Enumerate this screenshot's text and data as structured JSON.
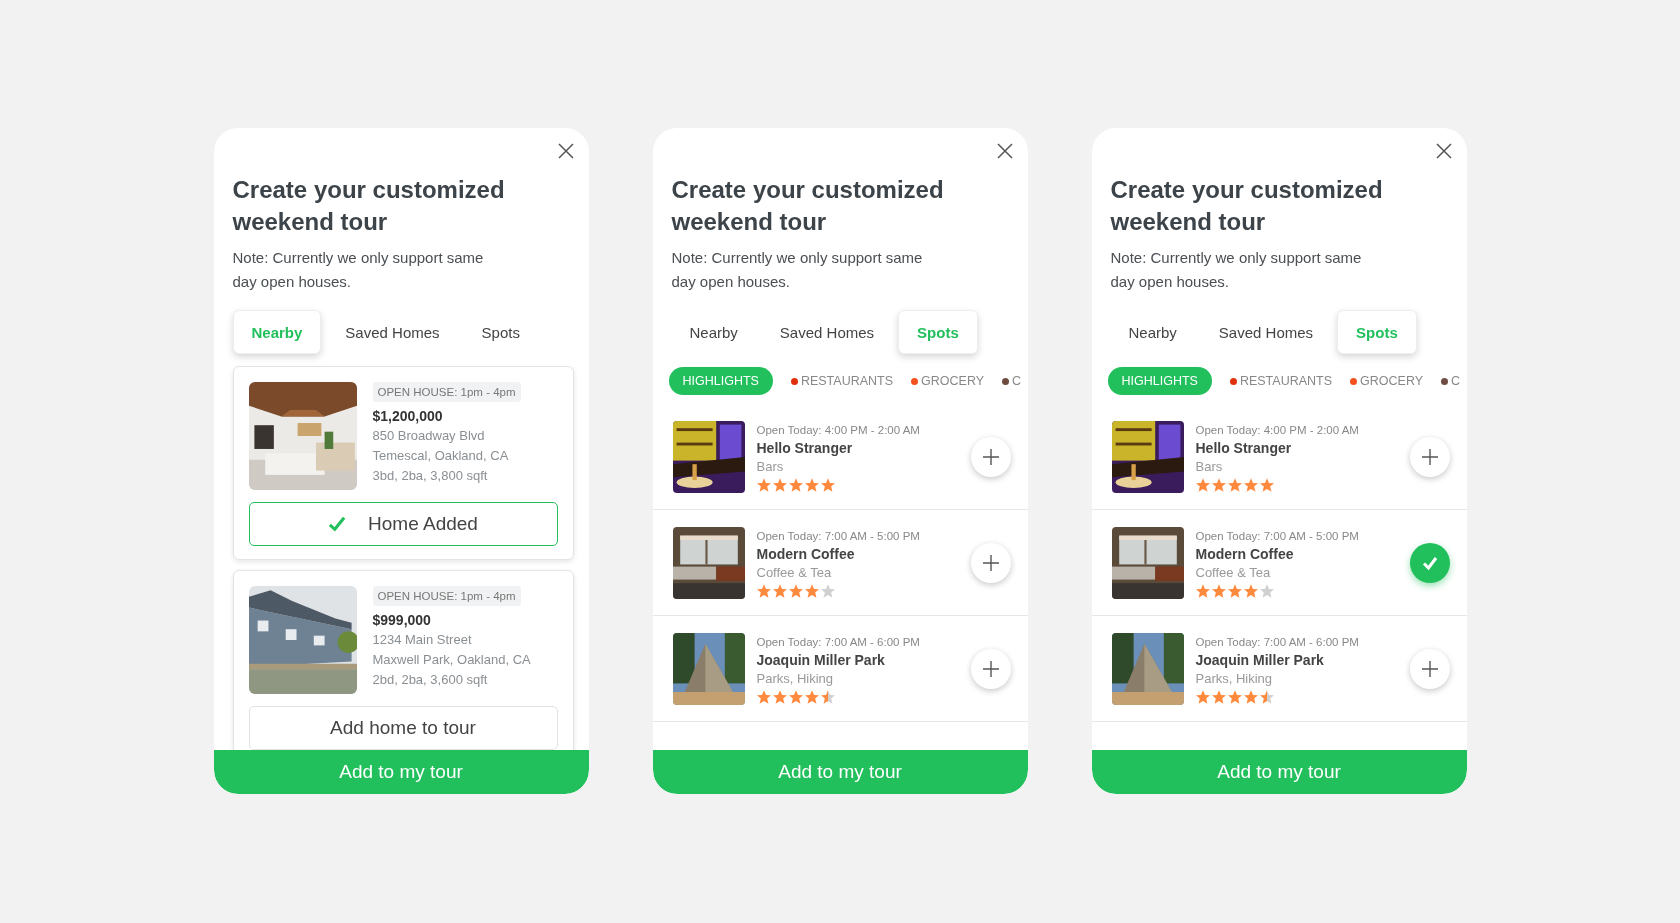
{
  "panels": [
    {
      "title": "Create your customized weekend tour",
      "note": "Note: Currently we only support same day open houses.",
      "tabs": [
        {
          "label": "Nearby",
          "selected": true
        },
        {
          "label": "Saved Homes",
          "selected": false
        },
        {
          "label": "Spots",
          "selected": false
        }
      ],
      "content": {
        "kind": "homes",
        "homes": [
          {
            "open_house": "OPEN HOUSE: 1pm - 4pm",
            "price": "$1,200,000",
            "address": "850 Broadway Blvd",
            "area": "Temescal, Oakland, CA",
            "details": "3bd, 2ba, 3,800 sqft",
            "button": "Home Added",
            "added": true
          },
          {
            "open_house": "OPEN HOUSE: 1pm - 4pm",
            "price": "$999,000",
            "address": "1234 Main Street",
            "area": "Maxwell Park, Oakland, CA",
            "details": "2bd, 2ba, 3,600 sqft",
            "button": "Add home to tour",
            "added": false
          }
        ]
      },
      "footer_button": "Add to my tour"
    },
    {
      "title": "Create your customized weekend tour",
      "note": "Note: Currently we only support same day open houses.",
      "tabs": [
        {
          "label": "Nearby",
          "selected": false
        },
        {
          "label": "Saved Homes",
          "selected": false
        },
        {
          "label": "Spots",
          "selected": true
        }
      ],
      "content": {
        "kind": "spots",
        "categories": [
          {
            "label": "HIGHLIGHTS",
            "selected": true
          },
          {
            "label": "RESTAURANTS",
            "selected": false,
            "color": "#e0300c"
          },
          {
            "label": "GROCERY",
            "selected": false,
            "color": "#f4511e"
          },
          {
            "label": "C",
            "selected": false,
            "color": "#6d4c41"
          }
        ],
        "spots": [
          {
            "hours": "Open Today: 4:00 PM - 2:00 AM",
            "name": "Hello Stranger",
            "category": "Bars",
            "stars": 5,
            "added": false
          },
          {
            "hours": "Open Today: 7:00 AM - 5:00 PM",
            "name": "Modern Coffee",
            "category": "Coffee & Tea",
            "stars": 4,
            "added": false
          },
          {
            "hours": "Open Today: 7:00 AM - 6:00 PM",
            "name": "Joaquin Miller Park",
            "category": "Parks, Hiking",
            "stars": 4.5,
            "added": false
          }
        ]
      },
      "footer_button": "Add to my tour"
    },
    {
      "title": "Create your customized weekend tour",
      "note": "Note: Currently we only support same day open houses.",
      "tabs": [
        {
          "label": "Nearby",
          "selected": false
        },
        {
          "label": "Saved Homes",
          "selected": false
        },
        {
          "label": "Spots",
          "selected": true
        }
      ],
      "content": {
        "kind": "spots",
        "categories": [
          {
            "label": "HIGHLIGHTS",
            "selected": true
          },
          {
            "label": "RESTAURANTS",
            "selected": false,
            "color": "#e0300c"
          },
          {
            "label": "GROCERY",
            "selected": false,
            "color": "#f4511e"
          },
          {
            "label": "C",
            "selected": false,
            "color": "#6d4c41"
          }
        ],
        "spots": [
          {
            "hours": "Open Today: 4:00 PM - 2:00 AM",
            "name": "Hello Stranger",
            "category": "Bars",
            "stars": 5,
            "added": false
          },
          {
            "hours": "Open Today: 7:00 AM - 5:00 PM",
            "name": "Modern Coffee",
            "category": "Coffee & Tea",
            "stars": 4,
            "added": true
          },
          {
            "hours": "Open Today: 7:00 AM - 6:00 PM",
            "name": "Joaquin Miller Park",
            "category": "Parks, Hiking",
            "stars": 4.5,
            "added": false
          }
        ]
      },
      "footer_button": "Add to my tour"
    }
  ]
}
